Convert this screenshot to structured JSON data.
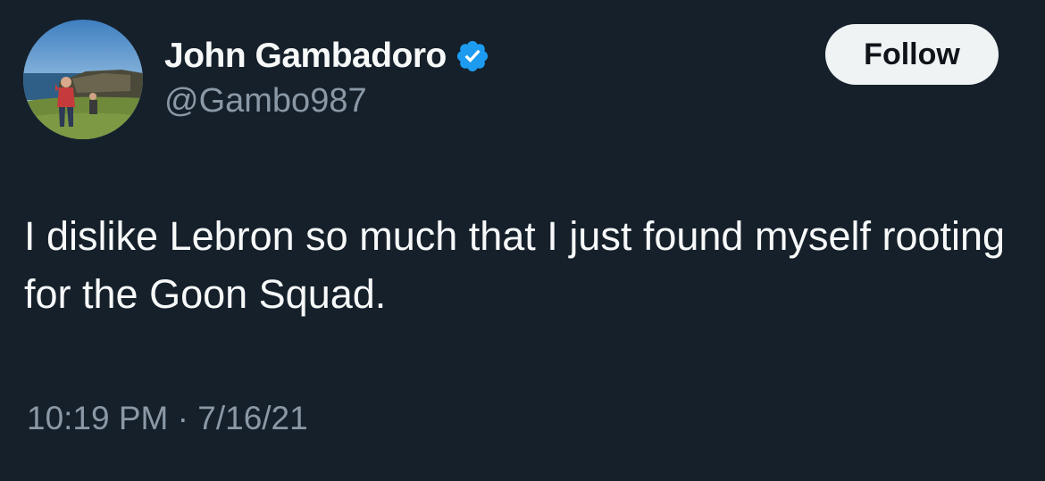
{
  "author": {
    "display_name": "John Gambadoro",
    "handle": "@Gambo987",
    "verified": true
  },
  "follow_button": {
    "label": "Follow"
  },
  "tweet": {
    "text": "I dislike Lebron so much that I just found myself rooting for the Goon Squad.",
    "time": "10:19 PM",
    "separator": "·",
    "date": "7/16/21"
  },
  "icons": {
    "verified": "verified-badge-icon"
  },
  "colors": {
    "background": "#15202b",
    "primary_text": "#f7f9f9",
    "secondary_text": "#8b98a5",
    "verified_blue": "#1d9bf0",
    "follow_button_bg": "#eff3f4",
    "follow_button_text": "#0f1419"
  }
}
